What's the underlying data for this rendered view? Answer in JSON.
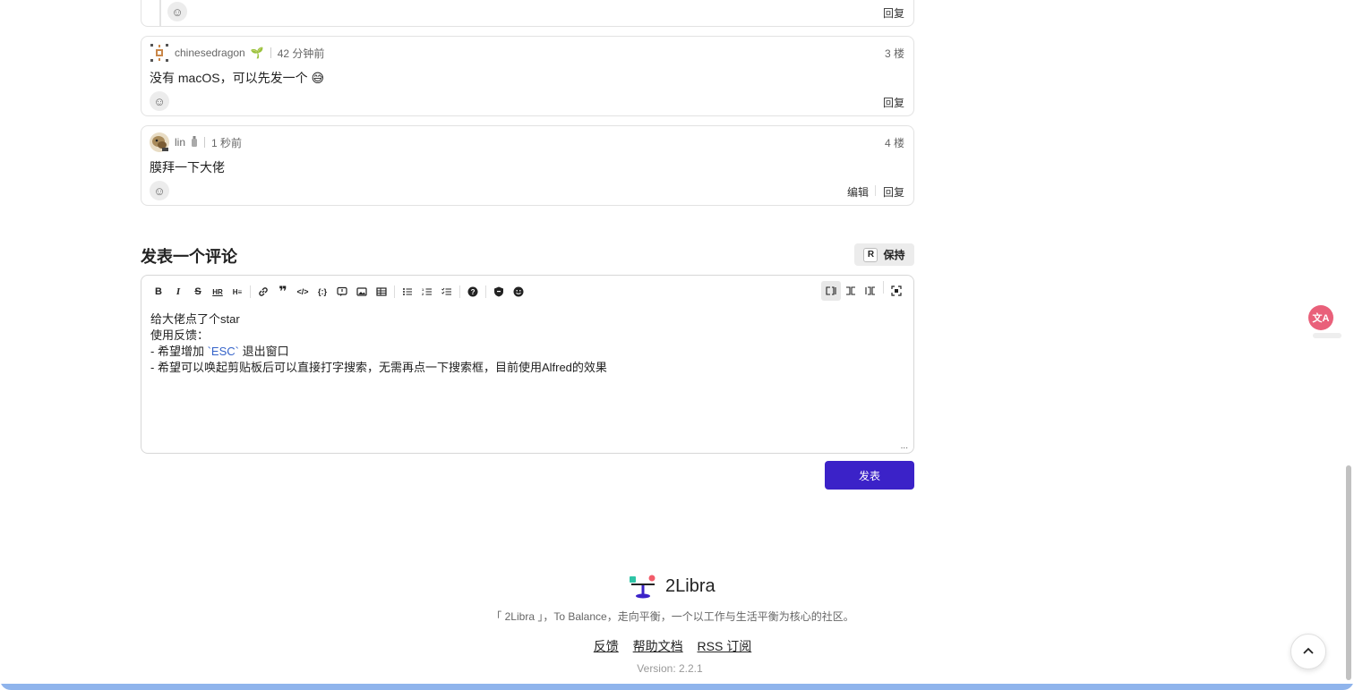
{
  "comments": [
    {
      "id": "c2-partial",
      "reply_label": "回复"
    },
    {
      "username": "chinesedragon",
      "badge_icon": "seedling-icon",
      "time": "42 分钟前",
      "floor": "3 楼",
      "text": "没有 macOS，可以先发一个 😅",
      "reply_label": "回复"
    },
    {
      "username": "lin",
      "badge_icon": "bottle-icon",
      "time": "1 秒前",
      "floor": "4 楼",
      "text": "膜拜一下大佬",
      "edit_label": "编辑",
      "reply_label": "回复"
    }
  ],
  "composer": {
    "title": "发表一个评论",
    "keep_key": "R",
    "keep_label": "保持",
    "toolbar_left": [
      "bold",
      "italic",
      "strike",
      "hr",
      "heading",
      "link",
      "quote",
      "inline-code",
      "code-block",
      "comment",
      "image",
      "table",
      "bullet-list",
      "ordered-list",
      "task-list",
      "help",
      "shield",
      "emoji"
    ],
    "toolbar_right": [
      "edit-mode",
      "split-mode",
      "preview-mode",
      "fullscreen"
    ],
    "lines": [
      "给大佬点了个star",
      "使用反馈：",
      "- 希望增加 ",
      "- 希望可以唤起剪贴板后可以直接打字搜索，无需再点一下搜索框，目前使用Alfred的效果"
    ],
    "line3_code": "`ESC`",
    "line3_suffix": " 退出窗口",
    "resize_label": "...",
    "submit_label": "发表"
  },
  "footer": {
    "logo_name": "2Libra",
    "tagline": "「 2Libra 」，To Balance，走向平衡，一个以工作与生活平衡为核心的社区。",
    "links": [
      "反馈",
      "帮助文档",
      "RSS 订阅"
    ],
    "version": "Version: 2.2.1"
  },
  "colors": {
    "accent": "#3b22c8",
    "translate": "#e9607a",
    "bottom_bar": "#8fb4ec"
  }
}
